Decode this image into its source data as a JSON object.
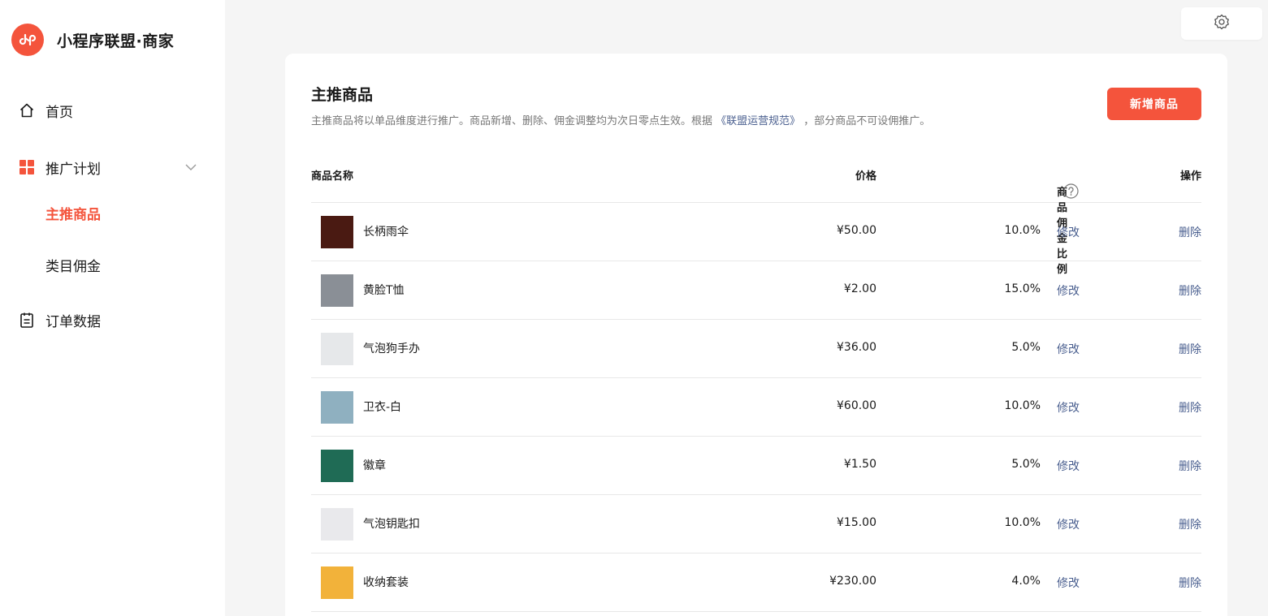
{
  "app": {
    "name": "小程序联盟·商家",
    "brand_color": "#f4543c",
    "logo_icon": "link-icon"
  },
  "sidebar": {
    "items": [
      {
        "label": "首页",
        "icon": "home-icon"
      },
      {
        "label": "推广计划",
        "icon": "grid-icon",
        "expanded": true
      },
      {
        "label": "主推商品",
        "active": true
      },
      {
        "label": "类目佣金"
      },
      {
        "label": "订单数据",
        "icon": "clipboard-icon"
      }
    ]
  },
  "header": {
    "settings_icon": "gear-icon"
  },
  "main": {
    "title": "主推商品",
    "desc_before": "主推商品将以单品维度进行推广。商品新增、删除、佣金调整均为次日零点生效。根据 ",
    "desc_link": "《联盟运营规范》",
    "desc_after": " ，部分商品不可设佣推广。",
    "add_button": "新增商品",
    "columns": {
      "name": "商品名称",
      "price": "价格",
      "commission": "商品佣金比例",
      "action": "操作"
    },
    "edit_label": "修改",
    "delete_label": "删除",
    "products": [
      {
        "name": "长柄雨伞",
        "price": "¥50.00",
        "rate": "10.0%",
        "thumb_color": "#4a1a12"
      },
      {
        "name": "黄脸T恤",
        "price": "¥2.00",
        "rate": "15.0%",
        "thumb_color": "#8a8f96"
      },
      {
        "name": "气泡狗手办",
        "price": "¥36.00",
        "rate": "5.0%",
        "thumb_color": "#e6e8ea"
      },
      {
        "name": "卫衣-白",
        "price": "¥60.00",
        "rate": "10.0%",
        "thumb_color": "#8fb0c0"
      },
      {
        "name": "徽章",
        "price": "¥1.50",
        "rate": "5.0%",
        "thumb_color": "#1f6b55"
      },
      {
        "name": "气泡钥匙扣",
        "price": "¥15.00",
        "rate": "10.0%",
        "thumb_color": "#e9e9ec"
      },
      {
        "name": "收纳套装",
        "price": "¥230.00",
        "rate": "4.0%",
        "thumb_color": "#f2b23a"
      }
    ]
  }
}
